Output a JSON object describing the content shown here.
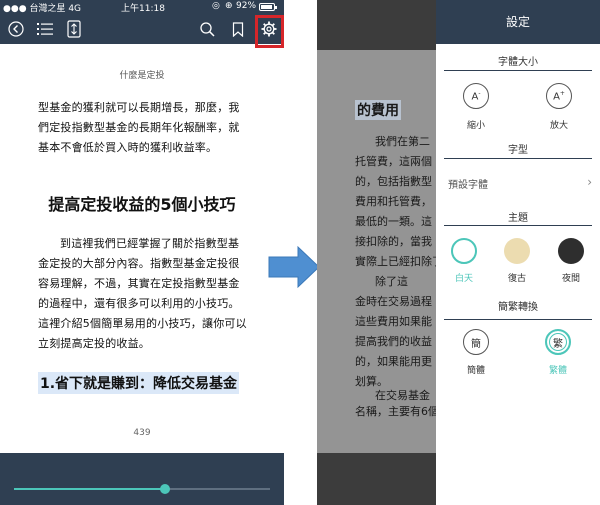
{
  "status": {
    "carrier": "台灣之星",
    "network": "4G",
    "time": "上午11:18",
    "battery": "92%"
  },
  "toolbar": {
    "icons": [
      "back-icon",
      "toc-icon",
      "chapter-icon",
      "search-icon",
      "bookmark-icon",
      "gear-icon"
    ]
  },
  "reader": {
    "book_title": "什麼是定投",
    "p1": "型基金的獲利就可以長期增長，那麼，我們定投指數型基金的長期年化報酬率，就基本不會低於買入時的獲利收益率。",
    "heading": "提高定投收益的5個小技巧",
    "p2": "到這裡我們已經掌握了關於指數型基金定投的大部分內容。指數型基金定投很容易理解，不過，其實在定投指數型基金的過程中，還有很多可以利用的小技巧。這裡介紹5個簡單易用的小技巧，讓你可以立刻提高定投的收益。",
    "heading2": "1.省下就是賺到：降低交易基金",
    "page": "439",
    "progress": 0.59
  },
  "background_page": {
    "heading": "的費用",
    "lines": [
      "我們在第二",
      "托管費，這兩個",
      "的，包括指數型",
      "費用和托管費，",
      "最低的一類。這",
      "接扣除的，當我",
      "實際上已經扣除了",
      "除了這",
      "金時在交易過程",
      "這些費用如果能",
      "提高我們的收益",
      "的，如果能用更",
      "划算。",
      "在交易基金",
      "名稱，主要有6個"
    ]
  },
  "settings": {
    "title": "設定",
    "font_size": {
      "title": "字體大小",
      "smaller": "縮小",
      "larger": "放大"
    },
    "font": {
      "title": "字型",
      "value": "預設字體",
      "chevron": "›"
    },
    "theme": {
      "title": "主題",
      "day": "白天",
      "retro": "復古",
      "night": "夜間",
      "selected": "白天"
    },
    "convert": {
      "title": "簡繁轉換",
      "simplified_glyph": "簡",
      "traditional_glyph": "繁",
      "simplified": "簡體",
      "traditional": "繁體",
      "selected": "繁體"
    },
    "colors": {
      "accent": "#4cc6b9",
      "header": "#2f3f52",
      "retro": "#ecdcb0",
      "night": "#2e2e2e",
      "highlight": "#d6262a"
    }
  }
}
